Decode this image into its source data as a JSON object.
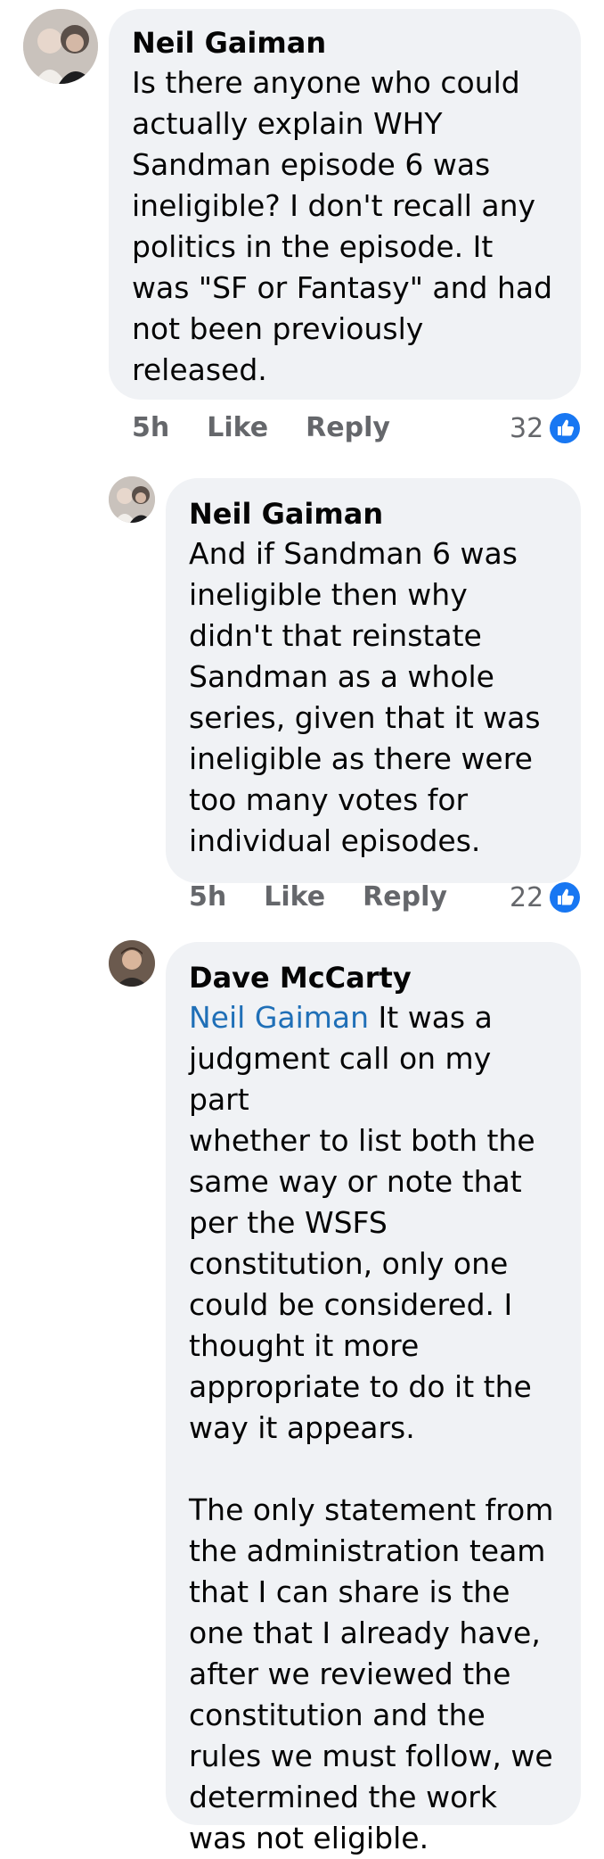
{
  "comments": [
    {
      "author": "Neil Gaiman",
      "text": "Is there anyone who could\nactually explain WHY\nSandman episode 6 was\nineligible?  I don't recall any\npolitics in the episode. It\nwas \"SF or Fantasy\" and had\nnot been previously\nreleased.",
      "time": "5h",
      "like_label": "Like",
      "reply_label": "Reply",
      "reaction_count": "32",
      "reaction_icon": "like-icon",
      "accent": "#1877f2"
    },
    {
      "author": "Neil Gaiman",
      "text": "And if Sandman 6 was\nineligible then why\ndidn't that reinstate\nSandman as a whole\nseries, given that it was\nineligible as there were\ntoo many votes for\nindividual episodes.",
      "time": "5h",
      "like_label": "Like",
      "reply_label": "Reply",
      "reaction_count": "22",
      "reaction_icon": "like-icon"
    },
    {
      "author": "Dave McCarty",
      "mention": "Neil Gaiman",
      "text": " It was a\njudgment call on my part\nwhether to list both the\nsame way or note that\nper the WSFS\nconstitution, only one\ncould be considered.  I\nthought it more\nappropriate to do it the\nway it appears.\n\nThe only statement from\nthe administration team\nthat I can share is the\none that I already have,\nafter we reviewed the\nconstitution and the\nrules we must follow, we\ndetermined the work\nwas not eligible.",
      "mention_color": "#1f6fb7"
    }
  ]
}
